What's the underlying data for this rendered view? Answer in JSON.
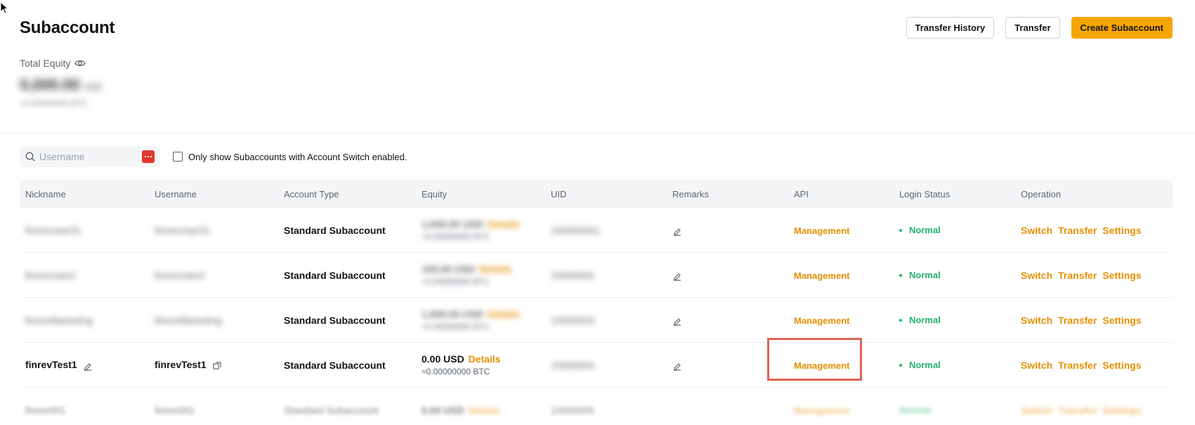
{
  "header": {
    "title": "Subaccount",
    "transfer_history_label": "Transfer History",
    "transfer_label": "Transfer",
    "create_label": "Create Subaccount"
  },
  "equity": {
    "label": "Total Equity",
    "value": "0,000.00",
    "unit": "USD",
    "btc": "≈0.00000000 BTC"
  },
  "filters": {
    "search_placeholder": "Username",
    "checkbox_label": "Only show Subaccounts with Account Switch enabled."
  },
  "table": {
    "columns": [
      "Nickname",
      "Username",
      "Account Type",
      "Equity",
      "UID",
      "Remarks",
      "API",
      "Login Status",
      "Operation"
    ],
    "rows": [
      {
        "nickname": "finrevUser01",
        "username": "finrevUser01",
        "type": "Standard Subaccount",
        "equity": "1,000.00 USD",
        "details": "Details",
        "btc": "≈0.00000000 BTC",
        "uid": "100000001",
        "api": "Management",
        "status": "Normal"
      },
      {
        "nickname": "finrevUser2",
        "username": "finrevUser2",
        "type": "Standard Subaccount",
        "equity": "100.00 USD",
        "details": "Details",
        "btc": "≈0.00000000 BTC",
        "uid": "10000002",
        "api": "Management",
        "status": "Normal"
      },
      {
        "nickname": "finrevMarketing",
        "username": "finrevMarketing",
        "type": "Standard Subaccount",
        "equity": "1,000.00 USD",
        "details": "Details",
        "btc": "≈0.00000000 BTC",
        "uid": "10000003",
        "api": "Management",
        "status": "Normal"
      },
      {
        "nickname": "finrevTest1",
        "username": "finrevTest1",
        "type": "Standard Subaccount",
        "equity": "0.00 USD",
        "details": "Details",
        "btc": "≈0.00000000 BTC",
        "uid": "10000004",
        "api": "Management",
        "status": "Normal"
      },
      {
        "nickname": "finrev001",
        "username": "finrev001",
        "type": "Standard Subaccount",
        "equity": "0.00 USD",
        "details": "Details",
        "btc": "",
        "uid": "10000005",
        "api": "Management",
        "status": "Normal"
      }
    ],
    "ops": {
      "switch": "Switch",
      "transfer": "Transfer",
      "settings": "Settings"
    }
  },
  "colors": {
    "accent": "#f7a600",
    "link": "#e58f00",
    "success": "#20b26c",
    "highlight": "#e06352"
  }
}
